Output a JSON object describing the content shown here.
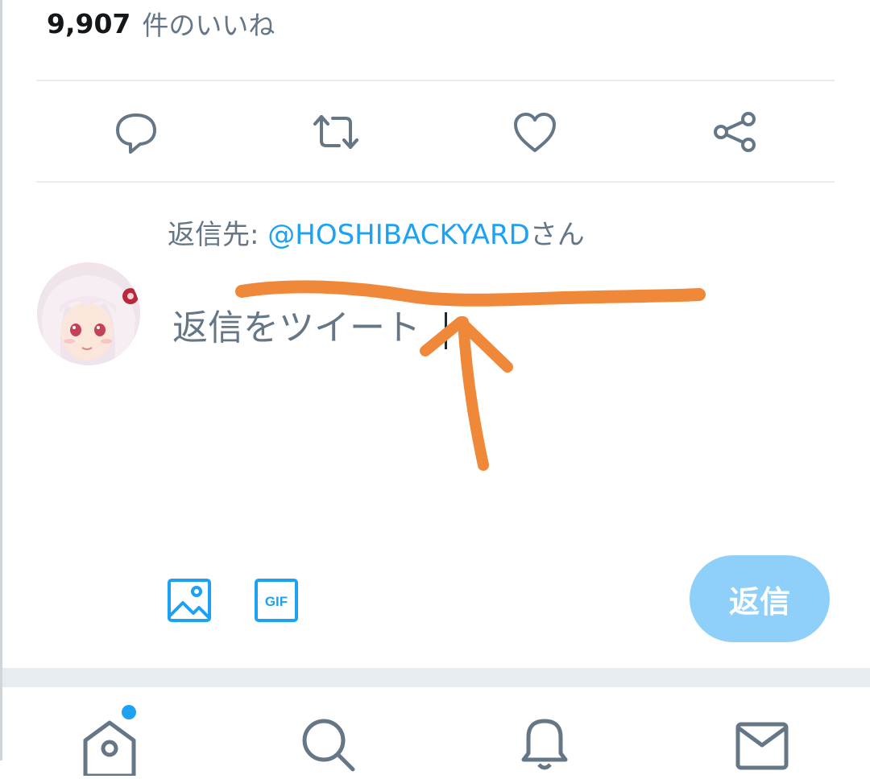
{
  "tweet": {
    "likes_count": "9,907",
    "likes_label": "件のいいね"
  },
  "actions": [
    "reply-icon",
    "retweet-icon",
    "like-icon",
    "share-icon"
  ],
  "reply": {
    "prefix": "返信先: ",
    "handle": "@HOSHIBACKYARD",
    "suffix": "さん",
    "compose_placeholder": "返信をツイート",
    "submit_label": "返信",
    "submit_state": "disabled"
  },
  "media_buttons": [
    "image-icon",
    "gif-icon"
  ],
  "gif_label": "GIF",
  "bottom_nav": {
    "items": [
      "home-icon",
      "search-icon",
      "notifications-icon",
      "messages-icon"
    ],
    "home_has_new": true
  },
  "colors": {
    "accent": "#1da1f2",
    "reply_button_disabled": "#8ed0f9",
    "icon_gray": "#657786",
    "annotation": "#f0883a"
  }
}
